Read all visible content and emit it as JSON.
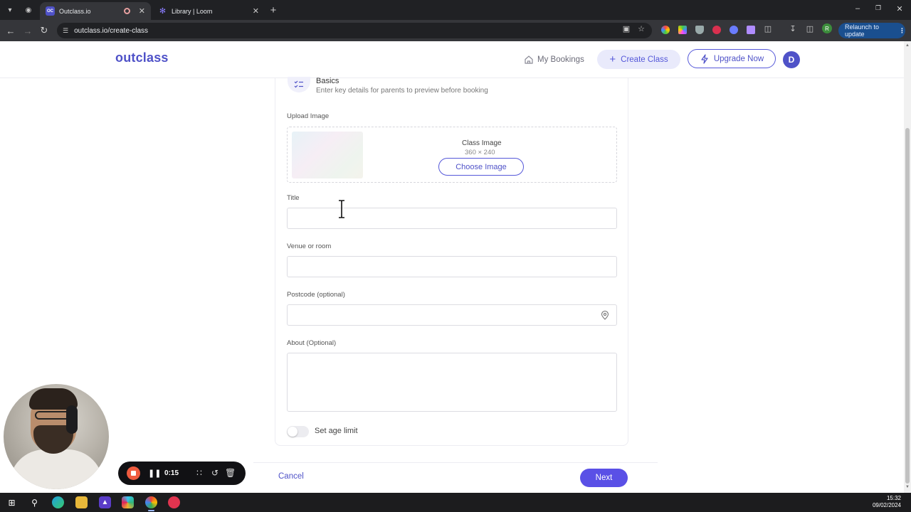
{
  "browser": {
    "tabs": [
      {
        "label": "Outclass.io",
        "favicon": "OC",
        "active": true
      },
      {
        "label": "Library | Loom",
        "active": false
      }
    ],
    "url": "outclass.io/create-class",
    "relaunch_label": "Relaunch to update",
    "profile_initial": "R"
  },
  "header": {
    "logo": "outclass",
    "my_bookings": "My Bookings",
    "create_class": "Create Class",
    "upgrade": "Upgrade Now",
    "avatar_initial": "D"
  },
  "form": {
    "section_title": "Basics",
    "section_subtitle": "Enter key details for parents to preview before booking",
    "upload_label": "Upload Image",
    "class_image_title": "Class Image",
    "class_image_size": "360 × 240",
    "choose_image": "Choose Image",
    "title_label": "Title",
    "title_value": "",
    "venue_label": "Venue or room",
    "venue_value": "",
    "postcode_label": "Postcode (optional)",
    "postcode_value": "",
    "about_label": "About (Optional)",
    "about_value": "",
    "age_limit_label": "Set age limit",
    "age_limit_on": false
  },
  "footer": {
    "cancel": "Cancel",
    "next": "Next"
  },
  "loom": {
    "timer": "0:15"
  },
  "taskbar": {
    "time": "15:32",
    "date": "09/02/2024"
  },
  "colors": {
    "brand": "#4f52c8",
    "primary_button": "#5a50e6",
    "record": "#ef5b3f"
  }
}
